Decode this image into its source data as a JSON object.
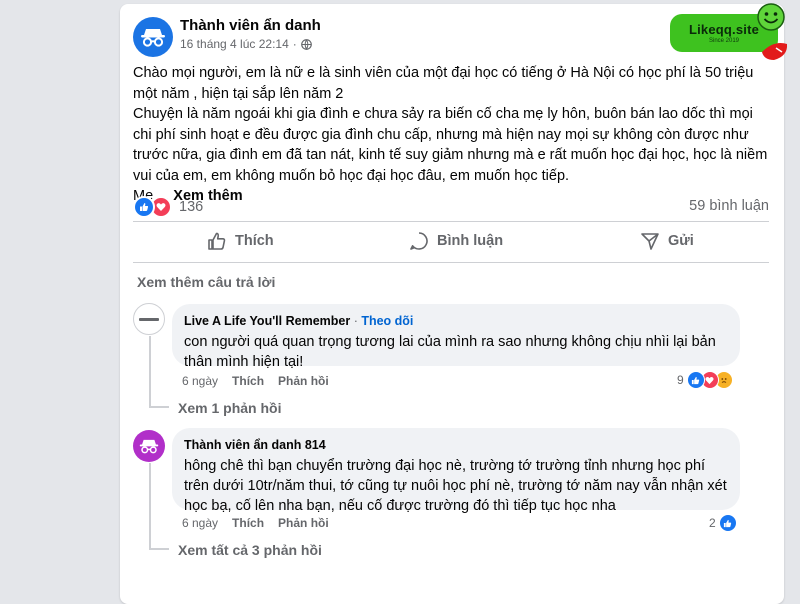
{
  "post": {
    "author": "Thành viên ẩn danh",
    "date": "16 tháng 4 lúc 22:14",
    "separator": "·",
    "privacy_icon": "globe-icon",
    "paragraphs": [
      "Chào mọi người, em là nữ e là sinh viên của một đại học có tiếng ở Hà Nội có học phí là 50 triệu một năm , hiện tại sắp lên năm 2",
      "Chuyện là năm ngoái khi gia đình e chưa sảy ra biến cố cha mẹ ly hôn, buôn bán lao dốc thì mọi chi phí sinh hoạt e đều được gia đình chu cấp, nhưng mà hiện nay mọi sự không còn được như trước nữa, gia đình em đã tan nát, kinh tế suy giảm nhưng mà e rất muốn học đại học, học là niềm vui của em, em không muốn bỏ học đại học đâu, em muốn học tiếp."
    ],
    "truncated_lead": "Mẹ ... ",
    "see_more": "Xem thêm",
    "reaction_count": "136",
    "comment_count": "59 bình luận",
    "actions": {
      "like": "Thích",
      "comment": "Bình luận",
      "share": "Gửi"
    }
  },
  "watermark": {
    "logo": "Likeqq.site",
    "tagline": "Since 2019"
  },
  "see_more_answers": "Xem thêm câu trả lời",
  "comments": [
    {
      "author": "Live A Life You'll Remember",
      "separator": " · ",
      "follow": "Theo dõi",
      "text": "con người quá quan trọng tương lai của mình ra sao nhưng không chịu nhìi lại bản thân mình hiện tại!",
      "time": "6 ngày",
      "like": "Thích",
      "reply": "Phản hồi",
      "reaction_count": "9",
      "view_replies": "Xem 1 phản hồi"
    },
    {
      "author": "Thành viên ẩn danh 814",
      "text": "hông chê thì bạn chuyển trường đại học nè, trường tớ trường tỉnh nhưng học phí trên dưới 10tr/năm thui, tớ cũng tự nuôi học phí nè, trường tớ năm nay vẫn nhận xét học bạ, cố lên nha bạn, nếu cố được trường đó thì tiếp tục học nha",
      "time": "6 ngày",
      "like": "Thích",
      "reply": "Phản hồi",
      "reaction_count": "2",
      "view_replies": "Xem tất cả 3 phản hồi"
    }
  ],
  "colors": {
    "accent": "#1877f2",
    "love": "#f33e58",
    "muted": "#65676b",
    "anon_purple": "#b12fc9",
    "watermark_green": "#3ec21f"
  }
}
